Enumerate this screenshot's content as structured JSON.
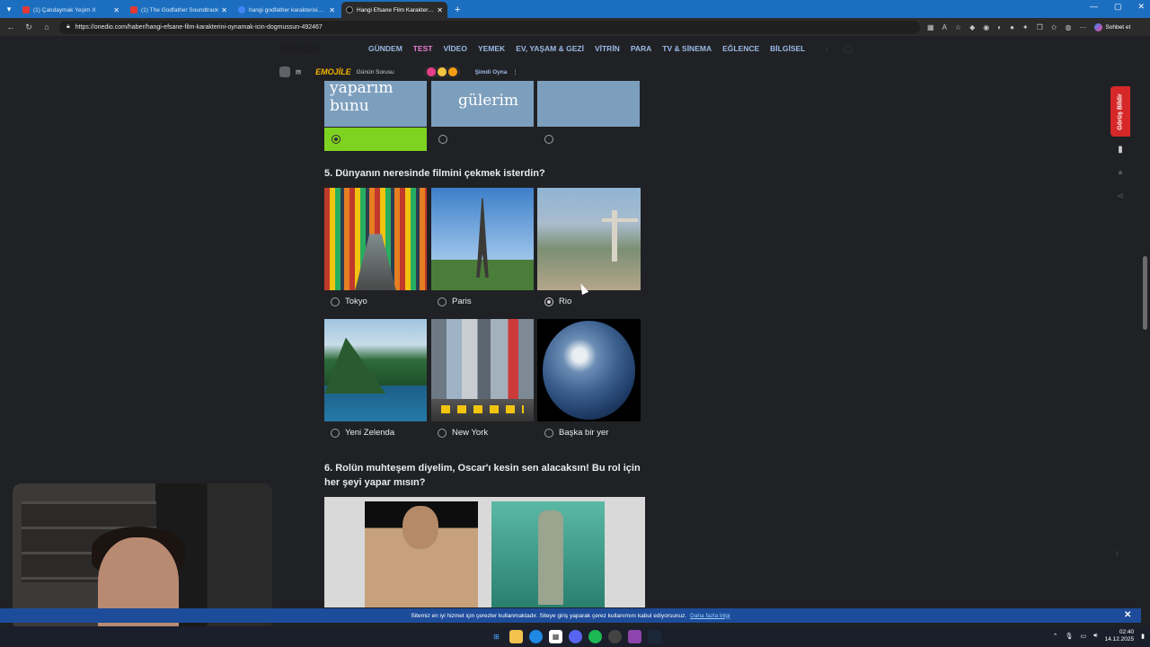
{
  "browser": {
    "tabs": [
      {
        "label": "(1) Çatıdaymak Yeşim X",
        "active": false,
        "color": "#e53935"
      },
      {
        "label": "(1) The Godfather Soundtrack",
        "active": false,
        "color": "#e53935"
      },
      {
        "label": "hangi godfather karakterisin - Goo",
        "active": false,
        "color": "#4285f4"
      },
      {
        "label": "Hangi Efsane Film Karakterini Oyn",
        "active": true,
        "color": "#111111"
      }
    ],
    "new_tab": "+",
    "url": "https://onedio.com/haber/hangi-efsane-film-karakterini-oynamak-icin-dogmussun-492467",
    "chat_label": "Sohbet et"
  },
  "site": {
    "logo": "onedio",
    "menu": [
      "GÜNDEM",
      "TEST",
      "VİDEO",
      "YEMEK",
      "EV, YAŞAM & GEZİ",
      "VİTRİN",
      "PARA",
      "TV & SİNEMA",
      "EĞLENCE",
      "BİLGİSEL"
    ],
    "subnav": {
      "brand": "EMOJİLE",
      "daily_question": "Günün Sorusu",
      "play_now": "Şimdi Oyna"
    }
  },
  "previous_question": {
    "cards": [
      {
        "text": "yaparım bunu",
        "selected": true
      },
      {
        "text": "gülerim",
        "selected": false
      },
      {
        "text": "",
        "selected": false
      }
    ]
  },
  "question5": {
    "title": "5. Dünyanın neresinde filmini çekmek isterdin?",
    "options": [
      {
        "label": "Tokyo",
        "selected": false
      },
      {
        "label": "Paris",
        "selected": false
      },
      {
        "label": "Rio",
        "selected": true
      },
      {
        "label": "Yeni Zelenda",
        "selected": false
      },
      {
        "label": "New York",
        "selected": false
      },
      {
        "label": "Başka bir yer",
        "selected": false
      }
    ]
  },
  "question6": {
    "title_line1": "6. Rolün muhteşem diyelim, Oscar'ı kesin sen alacaksın! Bu rol için",
    "title_line2": "her şeyi yapar mısın?"
  },
  "feedback": {
    "label": "Görüş Bildir"
  },
  "cookie_banner": {
    "text": "Sitemiz en iyi hizmet için çerezler kullanmaktadır. Siteye giriş yaparak çerez kullanımını kabul ediyorsunuz.",
    "more_link": "Daha fazla bilgi"
  },
  "taskbar": {
    "time": "02:40",
    "date": "14.12.2025"
  },
  "colors": {
    "selected_option": "#7ed321",
    "accent_test": "#e87ad2",
    "feedback_red": "#d62828",
    "cookie_bg": "#1d4c9a"
  }
}
